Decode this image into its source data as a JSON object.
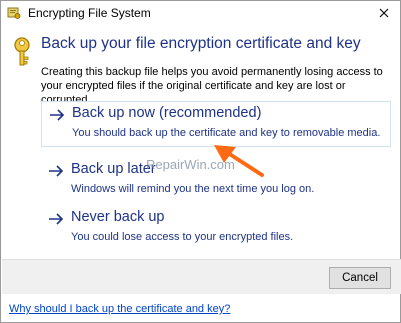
{
  "window": {
    "title": "Encrypting File System"
  },
  "dialog": {
    "heading": "Back up your file encryption certificate and key",
    "description": "Creating this backup file helps you avoid permanently losing access to your encrypted files if the original certificate and key are lost or corrupted."
  },
  "options": [
    {
      "title": "Back up now (recommended)",
      "subtitle": "You should back up the certificate and key to removable media."
    },
    {
      "title": "Back up later",
      "subtitle": "Windows will remind you the next time you log on."
    },
    {
      "title": "Never back up",
      "subtitle": "You could lose access to your encrypted files."
    }
  ],
  "watermark": "RepairWin.com",
  "footer": {
    "cancel_label": "Cancel"
  },
  "help_link": "Why should I back up the certificate and key?",
  "colors": {
    "heading": "#1e3287",
    "link": "#0044cc",
    "pointer": "#ff6a13"
  }
}
